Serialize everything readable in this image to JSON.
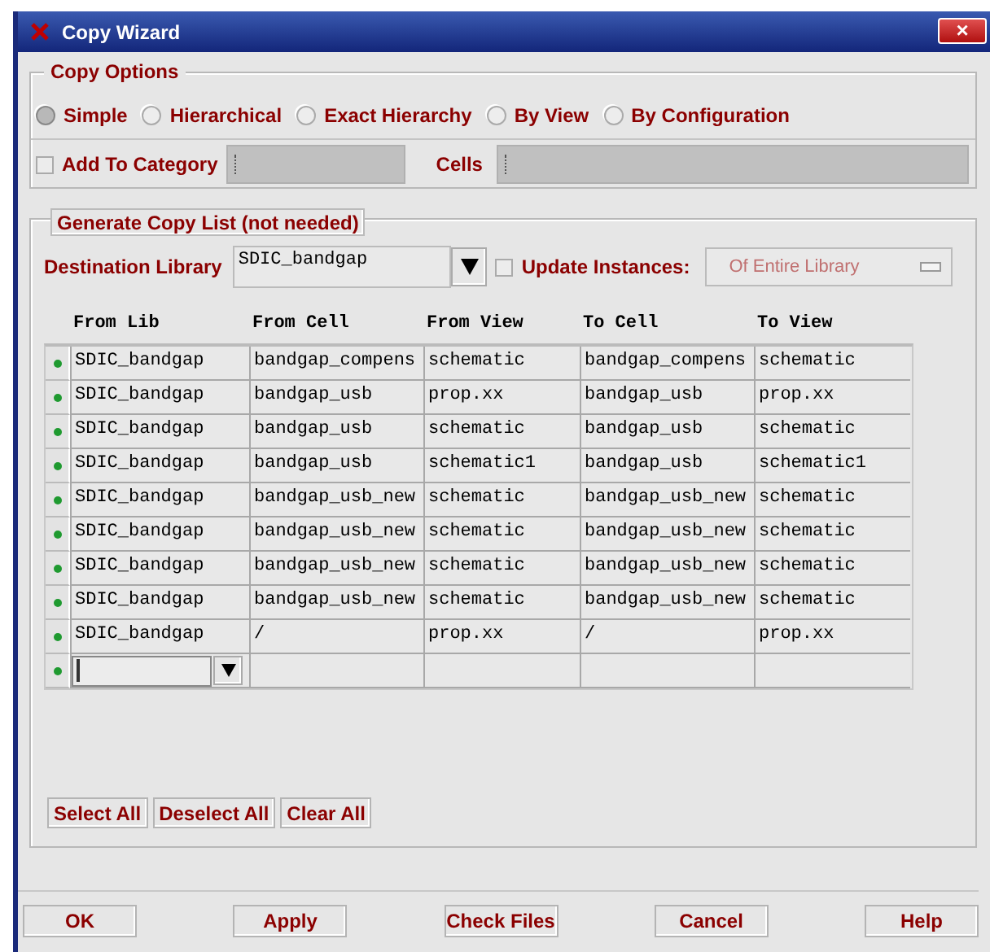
{
  "window": {
    "title": "Copy Wizard",
    "close": "×"
  },
  "copy_options": {
    "title": "Copy Options",
    "modes": [
      {
        "label": "Simple",
        "selected": true
      },
      {
        "label": "Hierarchical",
        "selected": false
      },
      {
        "label": "Exact Hierarchy",
        "selected": false
      },
      {
        "label": "By View",
        "selected": false
      },
      {
        "label": "By Configuration",
        "selected": false
      }
    ],
    "add_to_category": {
      "label": "Add To Category",
      "checked": false
    },
    "cells_label": "Cells"
  },
  "copy_list": {
    "title": "Generate Copy List (not needed)",
    "destination_label": "Destination Library",
    "destination_value": "SDIC_bandgap",
    "update_instances": {
      "label": "Update Instances:",
      "checked": false
    },
    "scope": {
      "value": "Of Entire Library",
      "disabled": true
    },
    "columns": [
      "From Lib",
      "From Cell",
      "From View",
      "To Cell",
      "To View"
    ],
    "rows": [
      {
        "kind": "item",
        "checked": true,
        "cells": [
          "SDIC_bandgap",
          "bandgap_compens",
          "schematic",
          "bandgap_compens",
          "schematic"
        ]
      },
      {
        "kind": "item",
        "checked": true,
        "cells": [
          "SDIC_bandgap",
          "bandgap_usb",
          "prop.xx",
          "bandgap_usb",
          "prop.xx"
        ]
      },
      {
        "kind": "item",
        "checked": true,
        "cells": [
          "SDIC_bandgap",
          "bandgap_usb",
          "schematic",
          "bandgap_usb",
          "schematic"
        ]
      },
      {
        "kind": "item",
        "checked": true,
        "cells": [
          "SDIC_bandgap",
          "bandgap_usb",
          "schematic1",
          "bandgap_usb",
          "schematic1"
        ]
      },
      {
        "kind": "item",
        "checked": true,
        "cells": [
          "SDIC_bandgap",
          "bandgap_usb_new",
          "schematic",
          "bandgap_usb_new",
          "schematic"
        ]
      },
      {
        "kind": "item",
        "checked": true,
        "cells": [
          "SDIC_bandgap",
          "bandgap_usb_new",
          "schematic",
          "bandgap_usb_new",
          "schematic"
        ]
      },
      {
        "kind": "item",
        "checked": true,
        "cells": [
          "SDIC_bandgap",
          "bandgap_usb_new",
          "schematic",
          "bandgap_usb_new",
          "schematic"
        ]
      },
      {
        "kind": "item",
        "checked": true,
        "cells": [
          "SDIC_bandgap",
          "bandgap_usb_new",
          "schematic",
          "bandgap_usb_new",
          "schematic"
        ]
      },
      {
        "kind": "item",
        "checked": true,
        "cells": [
          "SDIC_bandgap",
          "/",
          "prop.xx",
          "/",
          "prop.xx"
        ]
      },
      {
        "kind": "new",
        "checked": true
      }
    ],
    "list_buttons": [
      "Select All",
      "Deselect All",
      "Clear All"
    ]
  },
  "buttons": [
    "OK",
    "Apply",
    "Check Files",
    "Cancel",
    "Help"
  ]
}
